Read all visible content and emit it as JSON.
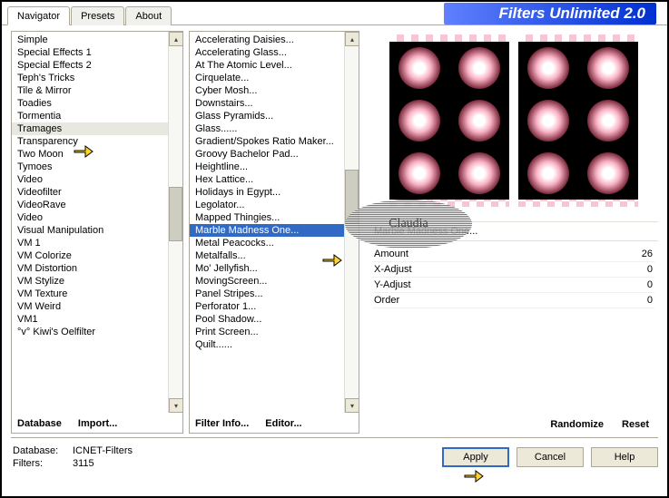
{
  "app": {
    "title": "Filters Unlimited 2.0"
  },
  "tabs": [
    {
      "label": "Navigator",
      "active": true
    },
    {
      "label": "Presets",
      "active": false
    },
    {
      "label": "About",
      "active": false
    }
  ],
  "categories": {
    "items": [
      "Simple",
      "Special Effects 1",
      "Special Effects 2",
      "Teph's Tricks",
      "Tile & Mirror",
      "Toadies",
      "Tormentia",
      "Tramages",
      "Transparency",
      "Two Moon",
      "Tymoes",
      "Video",
      "Videofilter",
      "VideoRave",
      "Video",
      "Visual Manipulation",
      "VM 1",
      "VM Colorize",
      "VM Distortion",
      "VM Stylize",
      "VM Texture",
      "VM Weird",
      "VM1",
      "°v° Kiwi's Oelfilter"
    ],
    "highlighted": "Tramages",
    "buttons": {
      "database": "Database",
      "import": "Import..."
    }
  },
  "filters": {
    "items": [
      "Accelerating Daisies...",
      "Accelerating Glass...",
      "At The Atomic Level...",
      "Cirquelate...",
      "Cyber Mosh...",
      "Downstairs...",
      "Glass Pyramids...",
      "Glass......",
      "Gradient/Spokes Ratio Maker...",
      "Groovy Bachelor Pad...",
      "Heightline...",
      "Hex Lattice...",
      "Holidays in Egypt...",
      "Legolator...",
      "Mapped Thingies...",
      "Marble Madness One...",
      "Metal Peacocks...",
      "Metalfalls...",
      "Mo' Jellyfish...",
      "MovingScreen...",
      "Panel Stripes...",
      "Perforator 1...",
      "Pool Shadow...",
      "Print Screen...",
      "Quilt......"
    ],
    "selected": "Marble Madness One...",
    "buttons": {
      "info": "Filter Info...",
      "editor": "Editor..."
    }
  },
  "preview": {
    "selected_label": "Marble Madness One...",
    "params": [
      {
        "name": "Amount",
        "value": "26"
      },
      {
        "name": "X-Adjust",
        "value": "0"
      },
      {
        "name": "Y-Adjust",
        "value": "0"
      },
      {
        "name": "Order",
        "value": "0"
      }
    ],
    "buttons": {
      "randomize": "Randomize",
      "reset": "Reset"
    }
  },
  "status": {
    "db_label": "Database:",
    "db_value": "ICNET-Filters",
    "filters_label": "Filters:",
    "filters_value": "3115"
  },
  "dialog": {
    "apply": "Apply",
    "cancel": "Cancel",
    "help": "Help"
  },
  "watermark": "Claudia"
}
